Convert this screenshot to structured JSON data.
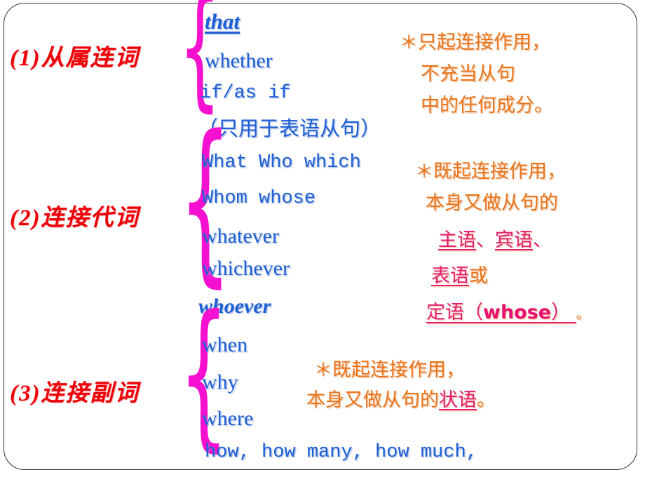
{
  "slide": {
    "title": "从句引导词分类",
    "colors": {
      "heading_red": "#ee0008",
      "brace_magenta": "#f511cf",
      "english_blue": "#1d5fd4",
      "note_orange": "#e8741c",
      "accent_pink": "#e21c72",
      "frame_border": "#333333",
      "background": "#ffffff"
    },
    "frame": {
      "shape": "rounded-rectangle",
      "radius": "30px"
    }
  },
  "sections": [
    {
      "id": "subordinating-conjunctions",
      "number": "(1)",
      "heading": "(1)从属连词",
      "brace": "{",
      "words": [
        {
          "text": "that",
          "style": "italic-underline"
        },
        {
          "text": "whether",
          "style": "serif"
        },
        {
          "text": "if/as if",
          "style": "mono"
        },
        {
          "text": "（只用于表语从句）",
          "style": "cjk"
        }
      ],
      "note": {
        "star": "＊",
        "lines": [
          "只起连接作用，",
          "不充当从句",
          "中的任何成分。"
        ]
      }
    },
    {
      "id": "connective-pronouns",
      "number": "(2)",
      "heading": "(2)连接代词",
      "brace": "{",
      "words": [
        {
          "text": "What  Who  which",
          "style": "mono"
        },
        {
          "text": "Whom  whose",
          "style": "mono"
        },
        {
          "text": "whatever",
          "style": "serif"
        },
        {
          "text": "whichever",
          "style": "serif"
        },
        {
          "text": "whoever",
          "style": "italic"
        }
      ],
      "note": {
        "star": "＊",
        "line1": "既起连接作用，",
        "line2": "本身又做从句的",
        "line3_a": "主语",
        "line3_sep1": "、",
        "line3_b": "宾语",
        "line3_sep2": "、",
        "line4_a": "表语",
        "line4_b": "或",
        "line5_a": "定语（",
        "line5_bold": "whose",
        "line5_b": "）",
        "line5_end": "。"
      }
    },
    {
      "id": "connective-adverbs",
      "number": "(3)",
      "heading": "(3)连接副词",
      "brace": "{",
      "words": [
        {
          "text": "when",
          "style": "serif"
        },
        {
          "text": "why",
          "style": "serif"
        },
        {
          "text": "where",
          "style": "serif"
        },
        {
          "text": "how, how many,  how much,",
          "style": "mono"
        }
      ],
      "note": {
        "star": "＊",
        "line1": "既起连接作用，",
        "line2_a": "本身又做从句的",
        "line2_b": "状语",
        "line2_end": "。"
      }
    }
  ]
}
